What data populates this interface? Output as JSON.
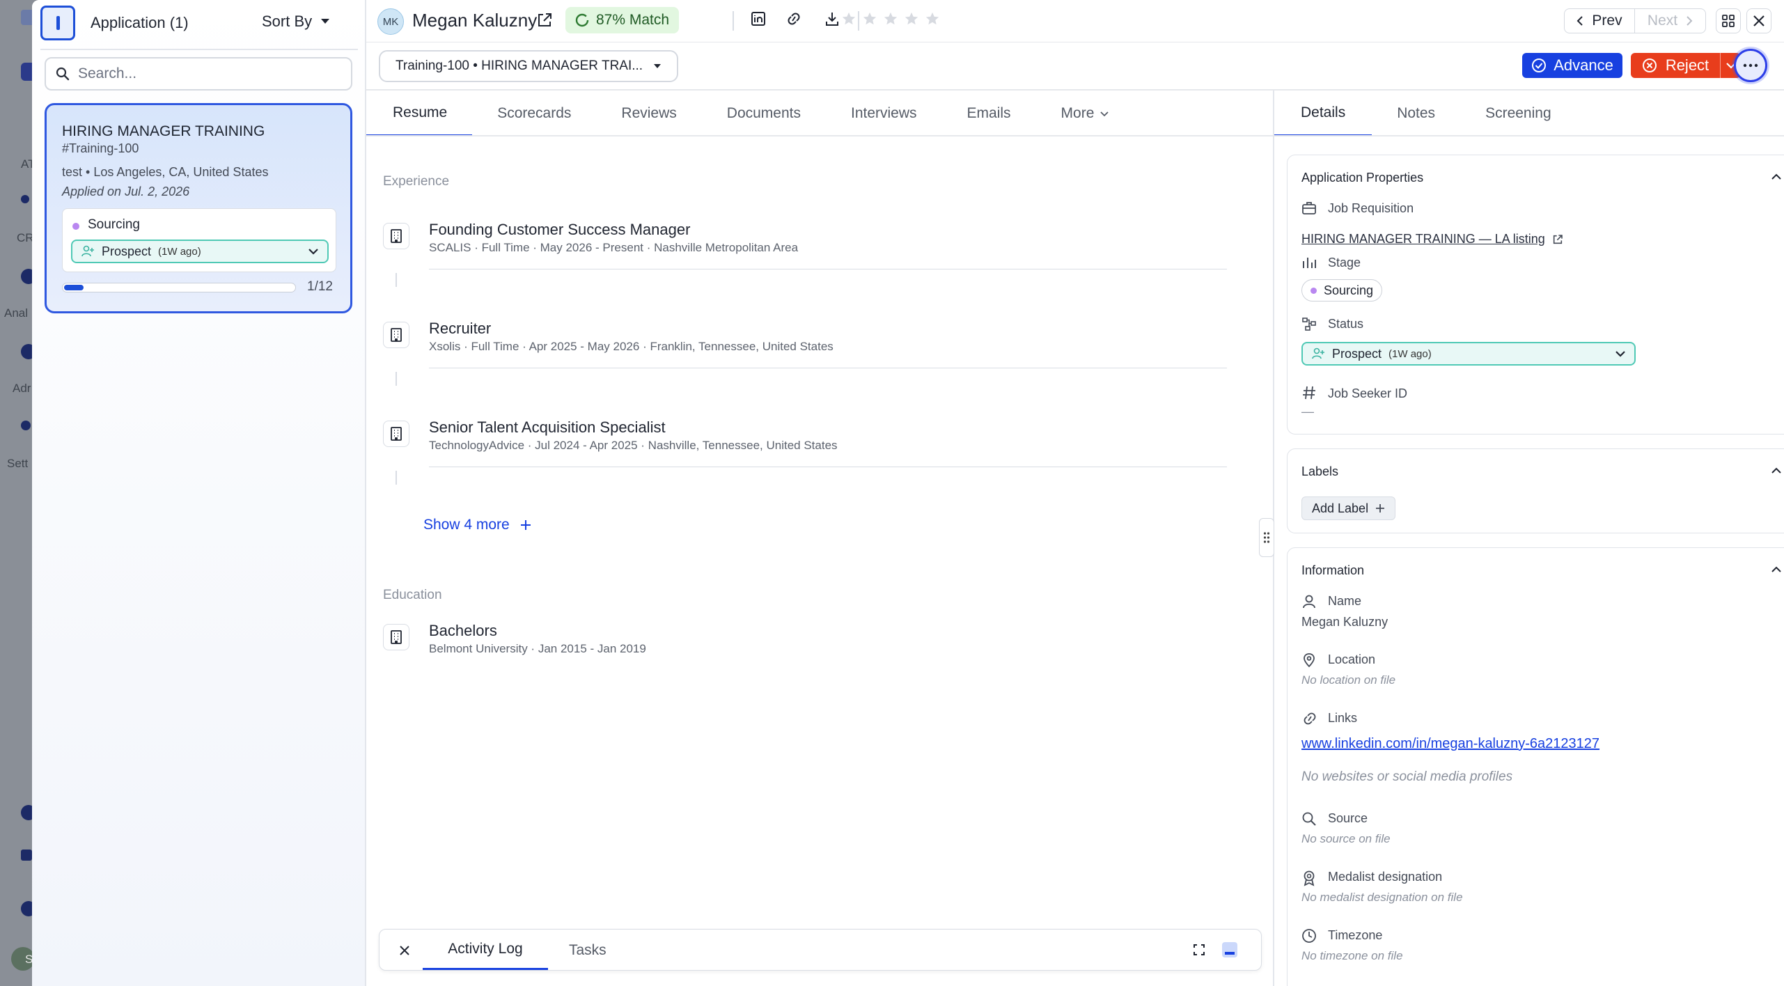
{
  "background_app": {
    "labels": [
      "AT",
      "CR",
      "Anal",
      "Adr",
      "Sett",
      "S"
    ]
  },
  "left_panel": {
    "title": "Application (1)",
    "sort_label": "Sort By",
    "search_placeholder": "Search...",
    "card": {
      "job_title": "HIRING MANAGER TRAINING",
      "job_code": "#Training-100",
      "location_line": "test • Los Angeles, CA, United States",
      "applied": "Applied on Jul. 2, 2026",
      "stage": "Sourcing",
      "status": "Prospect",
      "status_age": "(1W ago)",
      "progress_label": "1/12",
      "progress_fraction": 0.083
    }
  },
  "header": {
    "avatar_initials": "MK",
    "candidate_name": "Megan Kaluzny",
    "match": "87% Match",
    "rating": 0,
    "rating_max": 5,
    "prev_label": "Prev",
    "next_label": "Next"
  },
  "action_bar": {
    "job_select_value": "Training-100 • HIRING MANAGER TRAI...",
    "advance_label": "Advance",
    "reject_label": "Reject"
  },
  "main_tabs": [
    "Resume",
    "Scorecards",
    "Reviews",
    "Documents",
    "Interviews",
    "Emails",
    "More"
  ],
  "resume": {
    "experience_heading": "Experience",
    "experience": [
      {
        "title": "Founding Customer Success Manager",
        "detail": "SCALIS · Full Time · May 2026 - Present · Nashville Metropolitan Area"
      },
      {
        "title": "Recruiter",
        "detail": "Xsolis · Full Time · Apr 2025 - May 2026 · Franklin, Tennessee, United States"
      },
      {
        "title": "Senior Talent Acquisition Specialist",
        "detail": "TechnologyAdvice · Jul 2024 - Apr 2025 · Nashville, Tennessee, United States"
      }
    ],
    "show_more": "Show 4 more",
    "education_heading": "Education",
    "education": [
      {
        "title": "Bachelors",
        "detail": "Belmont University · Jan 2015 - Jan 2019"
      }
    ]
  },
  "activity": {
    "tab_active": "Activity Log",
    "tab_other": "Tasks"
  },
  "right_tabs": [
    "Details",
    "Notes",
    "Screening"
  ],
  "details": {
    "app_props_title": "Application Properties",
    "job_req_label": "Job Requisition",
    "job_req_link": "HIRING MANAGER TRAINING — LA listing",
    "stage_label": "Stage",
    "stage_value": "Sourcing",
    "status_label": "Status",
    "status_value": "Prospect",
    "status_age": "(1W ago)",
    "seeker_label": "Job Seeker ID",
    "seeker_value": "—",
    "labels_title": "Labels",
    "add_label": "Add Label",
    "info_title": "Information",
    "name_label": "Name",
    "name_value": "Megan Kaluzny",
    "location_label": "Location",
    "location_value": "No location on file",
    "links_label": "Links",
    "links_value": "www.linkedin.com/in/megan-kaluzny-6a2123127",
    "links_empty": "No websites or social media profiles",
    "source_label": "Source",
    "source_value": "No source on file",
    "medalist_label": "Medalist designation",
    "medalist_value": "No medalist designation on file",
    "timezone_label": "Timezone",
    "timezone_value": "No timezone on file"
  },
  "colors": {
    "primary": "#1740e0",
    "reject": "#e83d1c",
    "match_bg": "#e2f7e0",
    "status_teal": "#4fc9b5",
    "stage_purple": "#b987f0"
  }
}
